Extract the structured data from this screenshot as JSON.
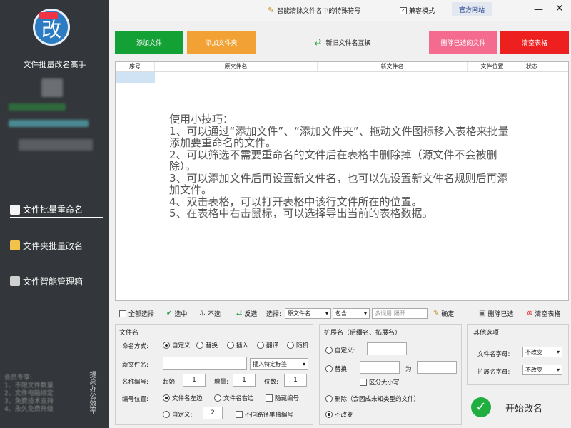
{
  "sidebar": {
    "logo_char": "改",
    "app_title": "文件批量改名高手",
    "nav": [
      {
        "label": "文件批量重命名"
      },
      {
        "label": "文件夹批量改名"
      },
      {
        "label": "文件智能管理箱"
      }
    ],
    "member_lines": [
      "会员专享:",
      "1、不限文件数量",
      "2、文件电脑绑定",
      "3、免费技术支持",
      "4、永久免费升级"
    ],
    "vertical_text": "提高办公效率"
  },
  "topbar": {
    "tip": "智能清除文件名中的特殊符号",
    "compat": "兼容模式",
    "official": "官方网站"
  },
  "buttons": {
    "add_file": "添加文件",
    "add_folder": "添加文件夹",
    "swap": "新旧文件名互换",
    "delete_selected": "删除已选的文件",
    "clear_table": "清空表格"
  },
  "colors": {
    "green": "#13a035",
    "orange": "#f2a235",
    "pink": "#f46b8f",
    "red": "#ee1f1f",
    "sidebar": "#33373b"
  },
  "table": {
    "columns": [
      "序号",
      "原文件名",
      "新文件名",
      "文件位置",
      "状态"
    ],
    "tips": [
      "使用小技巧：",
      "1、可以通过“添加文件”、“添加文件夹”、拖动文件图标移入表格来批量添加要重命名的文件。",
      "2、可以筛选不需要重命名的文件后在表格中删除掉（源文件不会被删除）。",
      "3、可以添加文件后再设置新文件名，也可以先设置新文件名规则后再添加文件。",
      "4、双击表格，可以打开表格中该行文件所在的位置。",
      "5、在表格中右击鼠标，可以选择导出当前的表格数据。"
    ]
  },
  "toolbar2": {
    "select_all": "全部选择",
    "select": "选中",
    "deselect": "不选",
    "invert": "反选",
    "choose": "选择:",
    "field": "原文件名",
    "contains": "包含",
    "keyword_placeholder": "多词用|隔开",
    "confirm": "确定",
    "delete_selected": "删除已选",
    "clear_table": "清空表格"
  },
  "filename": {
    "title": "文件名",
    "mode_label": "命名方式:",
    "modes": [
      "自定义",
      "替换",
      "插入",
      "翻译",
      "随机"
    ],
    "new_name_label": "新文件名:",
    "insert_tag": "插入特定标签",
    "numbering_label": "名称编号:",
    "start_label": "起始:",
    "start": "1",
    "step_label": "增量:",
    "step": "1",
    "digits_label": "位数:",
    "digits": "1",
    "position_label": "编号位置:",
    "pos_left": "文件名左边",
    "pos_right": "文件名右边",
    "hide_number": "隐藏编号",
    "custom_label": "自定义:",
    "custom_value": "2",
    "no_repeat": "不同路径单独编号"
  },
  "extension": {
    "title": "扩展名（后缀名、拓展名）",
    "custom": "自定义:",
    "replace": "替换:",
    "to": "为",
    "case_sensitive": "区分大小写",
    "remove": "删除（会因成未知类型的文件）",
    "unchanged": "不改变"
  },
  "other": {
    "title": "其他选项",
    "name_case_label": "文件名字母:",
    "name_case": "不改变",
    "ext_case_label": "扩展名字母:",
    "ext_case": "不改变",
    "start_rename": "开始改名"
  }
}
